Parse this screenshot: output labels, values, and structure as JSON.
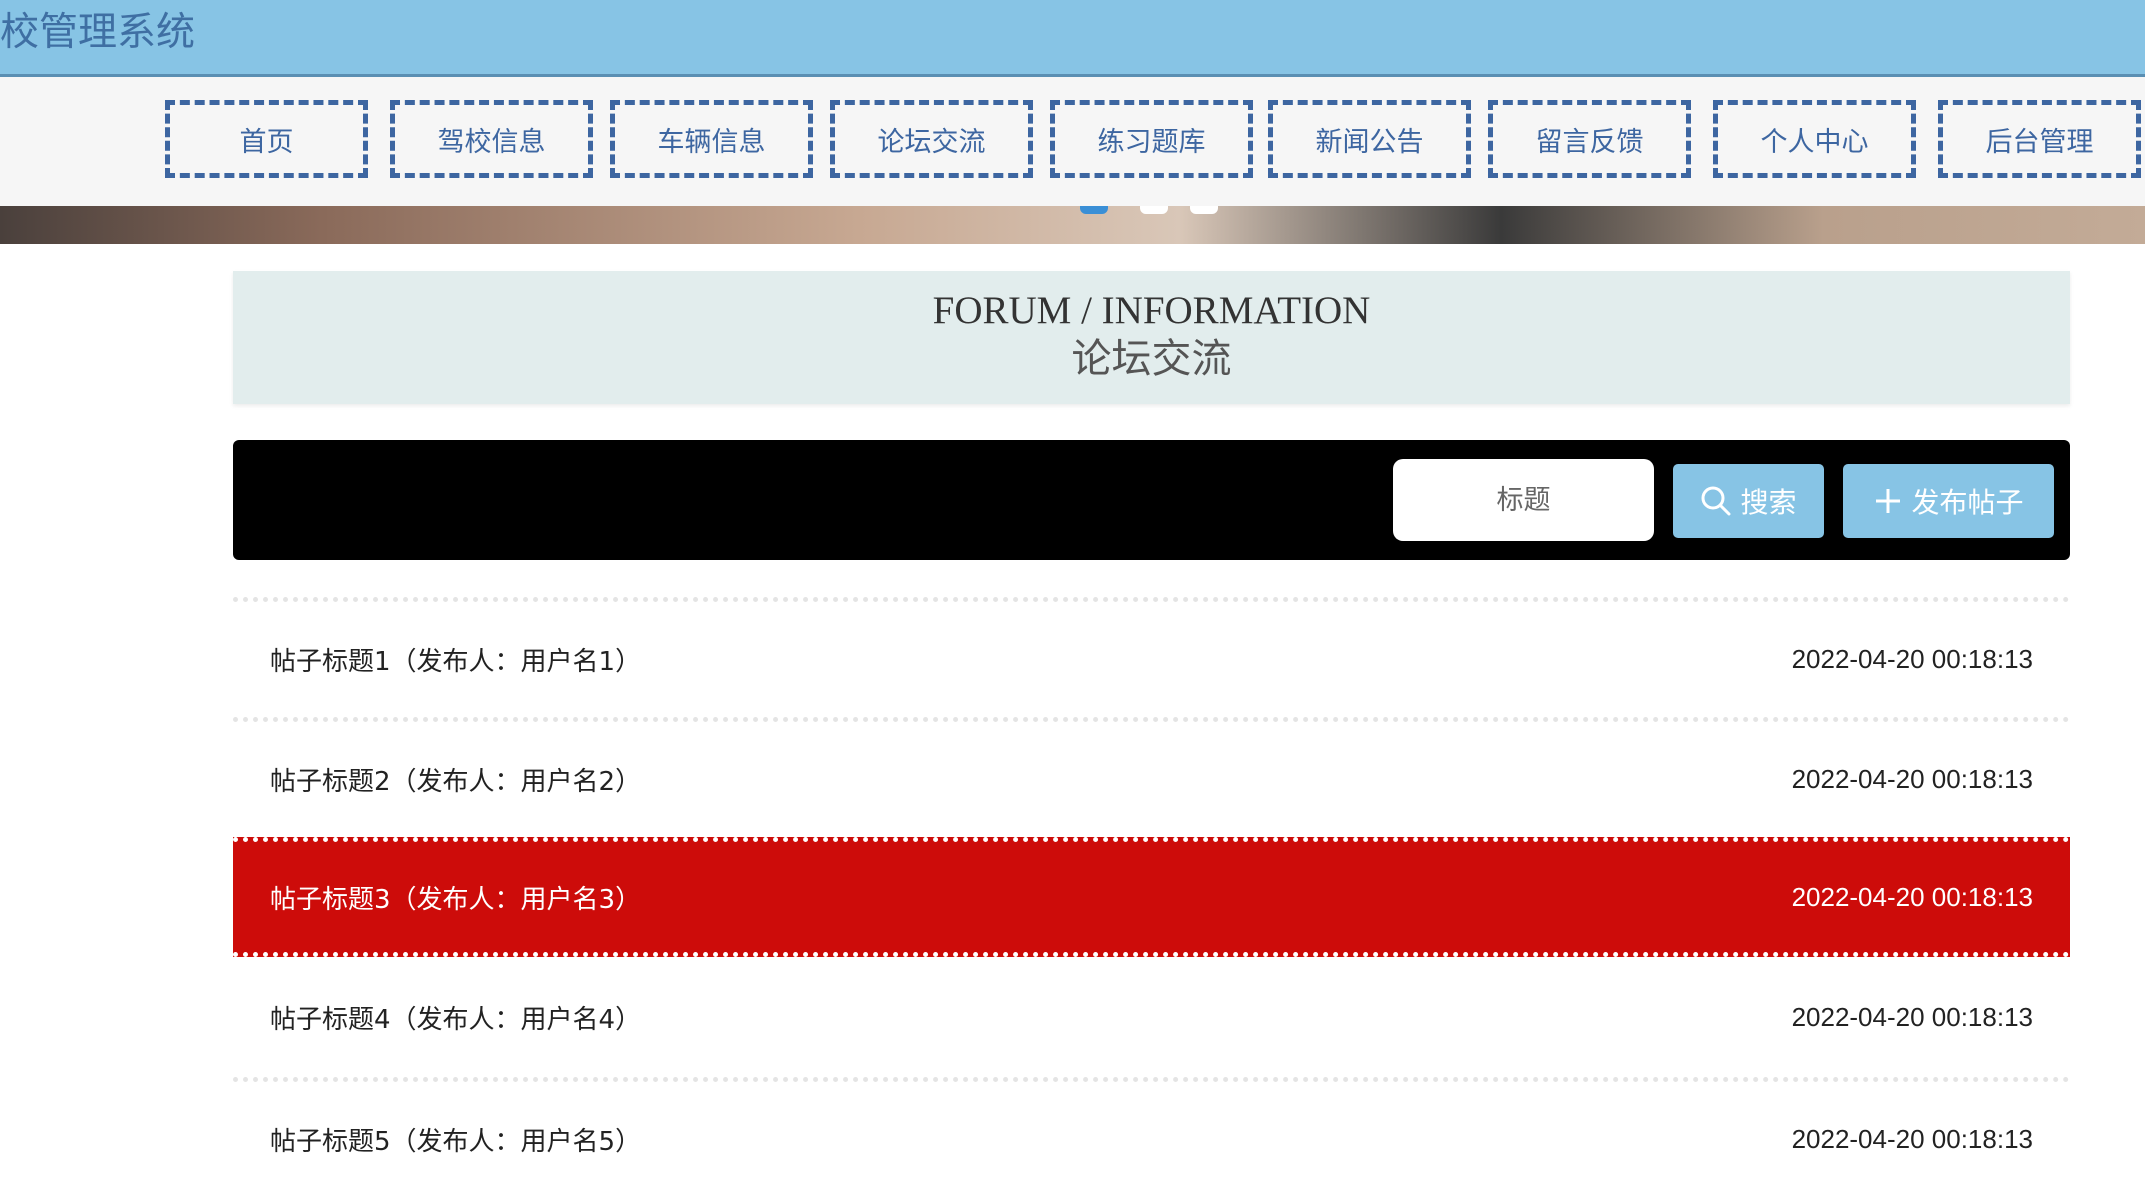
{
  "header": {
    "title": "校管理系统"
  },
  "nav": {
    "items": [
      {
        "label": "首页"
      },
      {
        "label": "驾校信息"
      },
      {
        "label": "车辆信息"
      },
      {
        "label": "论坛交流"
      },
      {
        "label": "练习题库"
      },
      {
        "label": "新闻公告"
      },
      {
        "label": "留言反馈"
      },
      {
        "label": "个人中心"
      },
      {
        "label": "后台管理"
      }
    ]
  },
  "section": {
    "title_en": "FORUM / INFORMATION",
    "title_cn": "论坛交流"
  },
  "toolbar": {
    "search_placeholder": "标题",
    "search_label": "搜索",
    "publish_label": "发布帖子"
  },
  "posts": [
    {
      "title": "帖子标题1（发布人：用户名1）",
      "time": "2022-04-20 00:18:13"
    },
    {
      "title": "帖子标题2（发布人：用户名2）",
      "time": "2022-04-20 00:18:13"
    },
    {
      "title": "帖子标题3（发布人：用户名3）",
      "time": "2022-04-20 00:18:13"
    },
    {
      "title": "帖子标题4（发布人：用户名4）",
      "time": "2022-04-20 00:18:13"
    },
    {
      "title": "帖子标题5（发布人：用户名5）",
      "time": "2022-04-20 00:18:13"
    }
  ],
  "colors": {
    "header_bg": "#87c4e5",
    "nav_border": "#3d66a1",
    "active_row": "#cd0c0a",
    "button_bg": "#87c4e5"
  },
  "icons": {
    "search": "search-icon",
    "plus": "plus-icon"
  }
}
